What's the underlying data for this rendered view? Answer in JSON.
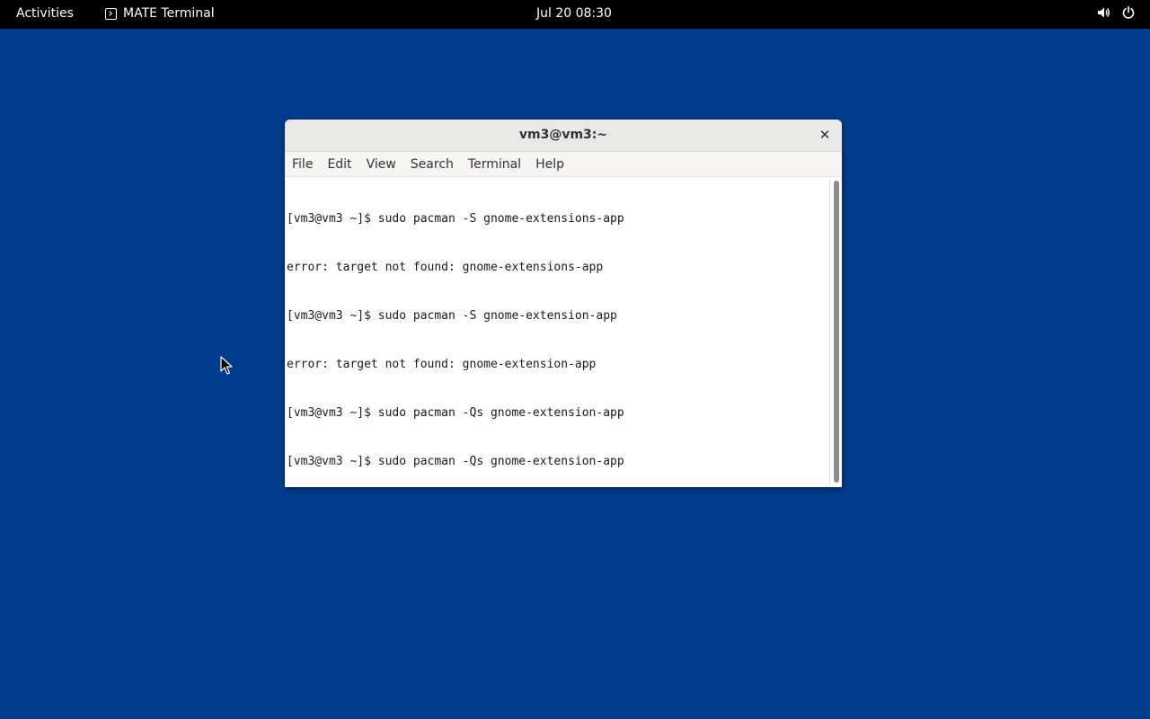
{
  "topbar": {
    "activities_label": "Activities",
    "app_name": "MATE Terminal",
    "app_icon": "terminal-icon",
    "datetime": "Jul 20  08:30",
    "tray_icons": [
      "volume-icon",
      "power-icon"
    ]
  },
  "window": {
    "title": "vm3@vm3:~",
    "close_glyph": "✕",
    "menu": [
      "File",
      "Edit",
      "View",
      "Search",
      "Terminal",
      "Help"
    ],
    "lines": [
      "[vm3@vm3 ~]$ sudo pacman -S gnome-extensions-app",
      "error: target not found: gnome-extensions-app",
      "[vm3@vm3 ~]$ sudo pacman -S gnome-extension-app",
      "error: target not found: gnome-extension-app",
      "[vm3@vm3 ~]$ sudo pacman -Qs gnome-extension-app",
      "[vm3@vm3 ~]$ sudo pacman -Qs gnome-extension-app"
    ]
  },
  "colors": {
    "desktop": "#003c8c",
    "topbar": "#000000",
    "terminal_bg": "#ffffff",
    "terminal_fg": "#1a1a1a"
  }
}
